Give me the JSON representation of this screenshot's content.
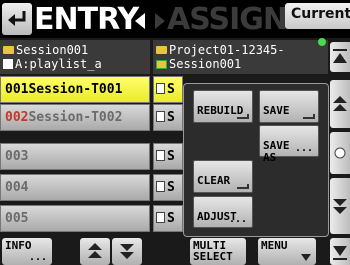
{
  "header": {
    "tab_entry": "ENTRY",
    "tab_assign": "ASSIGN",
    "current_label": "Current"
  },
  "left_header": {
    "line1": "Session001",
    "line2": "A:playlist_a"
  },
  "right_header": {
    "line1": "Project01-12345-",
    "line2": "Session001"
  },
  "entries": [
    {
      "number": "001",
      "name": "Session-T001",
      "right_label": "S",
      "selected": true
    },
    {
      "number": "002",
      "name": "Session-T002",
      "right_label": "S",
      "selected": false
    },
    {
      "number": "003",
      "name": "",
      "right_label": "S",
      "selected": false
    },
    {
      "number": "004",
      "name": "",
      "right_label": "S",
      "selected": false
    },
    {
      "number": "005",
      "name": "",
      "right_label": "S",
      "selected": false
    }
  ],
  "popup": {
    "rebuild": "REBUILD",
    "save": "SAVE",
    "save_as": "SAVE\nAS",
    "clear": "CLEAR",
    "adjust": "ADJUST"
  },
  "bottom": {
    "info": "INFO",
    "multi_select": "MULTI\nSELECT",
    "menu": "MENU",
    "ellipsis": "..."
  },
  "colors": {
    "selected_row": "#f0f040",
    "button_face": "#cfcfcf",
    "header_bg": "#000000",
    "ready_indicator": "#4cd94c"
  }
}
